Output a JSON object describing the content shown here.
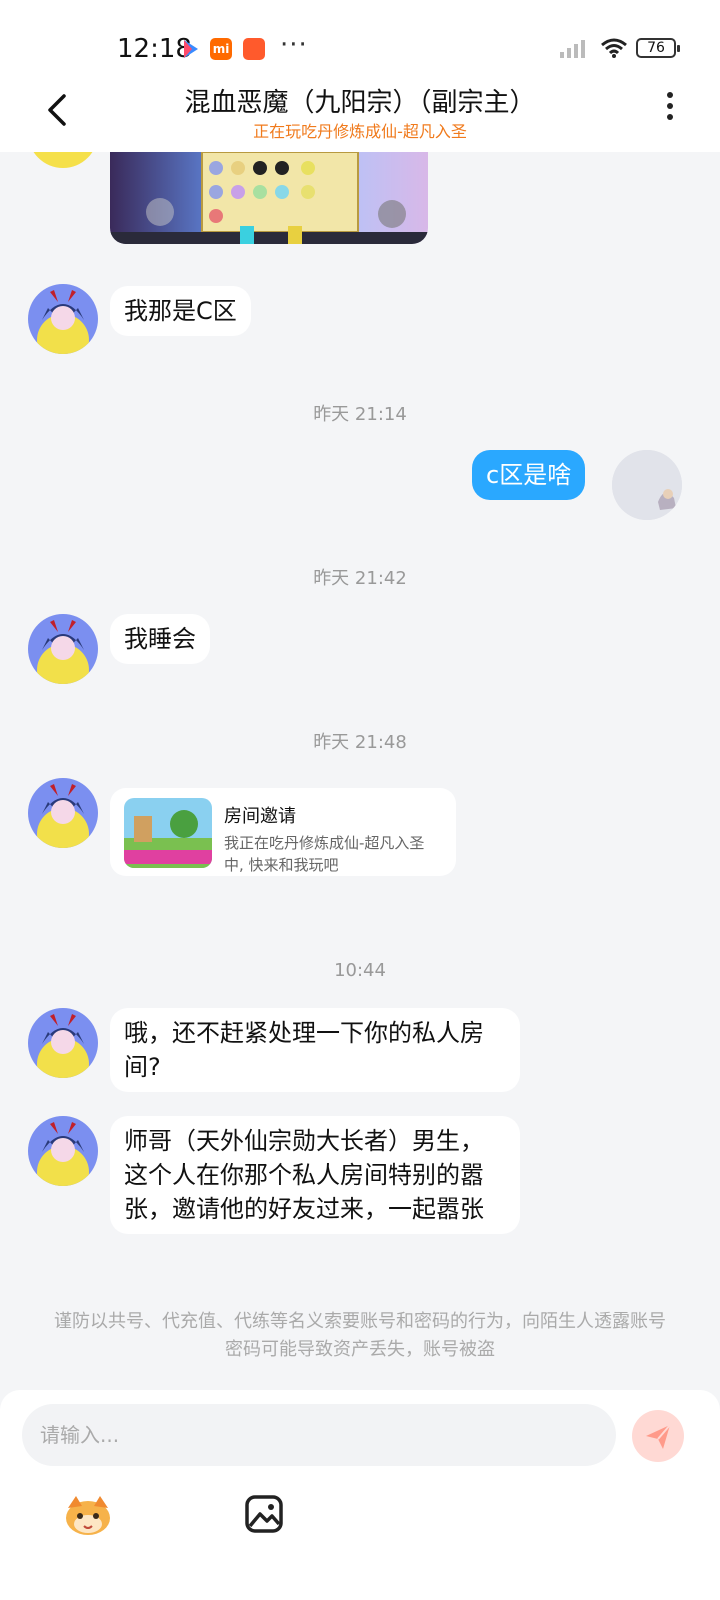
{
  "status_bar": {
    "time": "12:18",
    "battery": "76"
  },
  "header": {
    "title": "混血恶魔（九阳宗）（副宗主）",
    "subtitle": "正在玩吃丹修炼成仙-超凡入圣"
  },
  "messages": {
    "m1": "我那是C区",
    "ts1": "昨天 21:14",
    "m2": "c区是啥",
    "ts2": "昨天 21:42",
    "m3": "我睡会",
    "ts3": "昨天 21:48",
    "invite": {
      "title": "房间邀请",
      "desc": "我正在吃丹修炼成仙-超凡入圣中, 快来和我玩吧"
    },
    "ts4": "10:44",
    "m4": "哦，还不赶紧处理一下你的私人房间?",
    "m5": "师哥（天外仙宗勋大长者）男生，这个人在你那个私人房间特别的嚣张，邀请他的好友过来，一起嚣张"
  },
  "notice": "谨防以共号、代充值、代练等名义索要账号和密码的行为，向陌生人透露账号密码可能导致资产丢失，账号被盗",
  "input": {
    "placeholder": "请输入..."
  },
  "colors": {
    "accent": "#2aa8ff",
    "subtitle": "#f07a1c",
    "send": "#ff7a6a"
  }
}
